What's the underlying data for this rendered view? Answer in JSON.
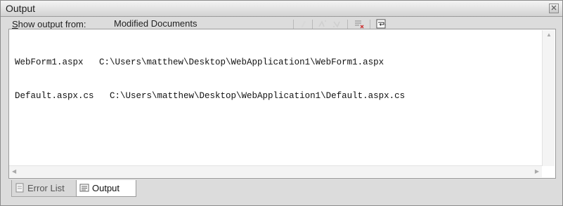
{
  "window": {
    "title": "Output"
  },
  "toolbar": {
    "show_output_prefix": "S",
    "show_output_rest": "how output from:",
    "source_selected": "Modified Documents"
  },
  "output": {
    "lines": [
      "WebForm1.aspx   C:\\Users\\matthew\\Desktop\\WebApplication1\\WebForm1.aspx",
      "Default.aspx.cs   C:\\Users\\matthew\\Desktop\\WebApplication1\\Default.aspx.cs"
    ]
  },
  "tabs": [
    {
      "label": "Error List",
      "active": false
    },
    {
      "label": "Output",
      "active": true
    }
  ],
  "icons": {
    "close": "close-icon",
    "error_list": "error-list-icon",
    "output": "output-icon"
  }
}
